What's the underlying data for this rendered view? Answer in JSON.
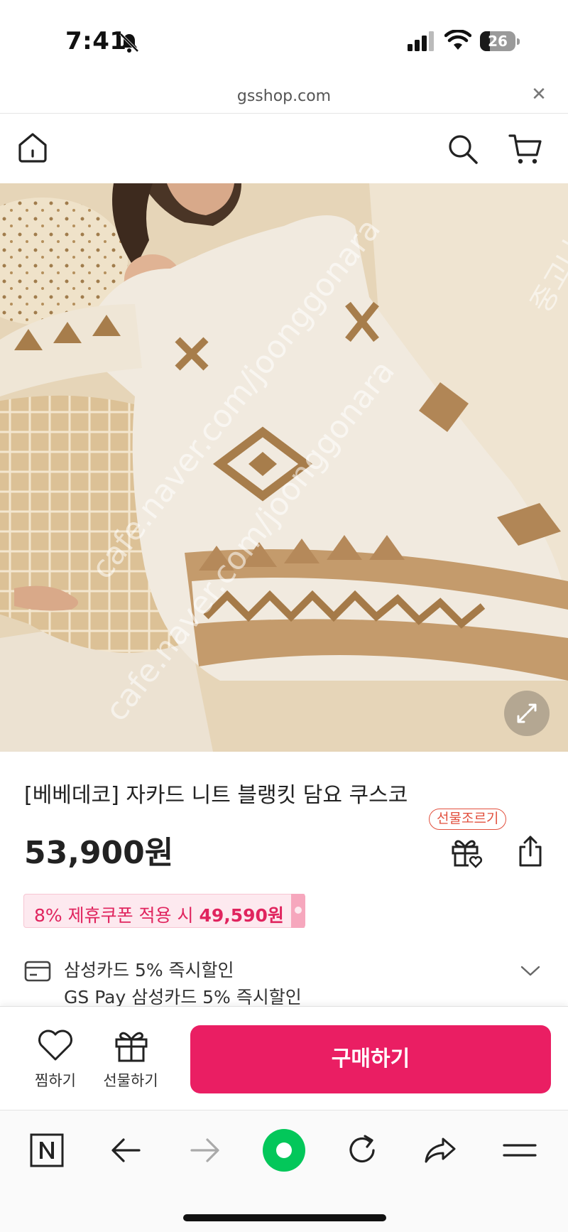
{
  "status_bar": {
    "time": "7:41",
    "battery_level": "26"
  },
  "url_bar": {
    "domain": "gsshop.com"
  },
  "product": {
    "title": "[베베데코] 자카드 니트 블랭킷 담요 쿠스코",
    "price": "53,900원",
    "gift_badge": "선물조르기",
    "coupon_prefix": "8% 제휴쿠폰 적용 시 ",
    "coupon_price": "49,590원",
    "card_discount_1": "삼성카드 5% 즉시할인",
    "card_discount_2": "GS Pay 삼성카드 5% 즉시할인"
  },
  "hero_image": {
    "watermark_1": "cafe.naver.com/joonggonara",
    "watermark_2": "cafe.naver.com/joonggonara",
    "watermark_3": "중고나라"
  },
  "action_bar": {
    "wish_label": "찜하기",
    "gift_label": "선물하기",
    "buy_label": "구매하기"
  },
  "colors": {
    "accent": "#ea1e63",
    "coupon_bg": "#fde9ef",
    "gift_badge": "#e2503e",
    "naver_green": "#03c75a"
  },
  "icons": [
    "bell-off-icon",
    "signal-icon",
    "wifi-icon",
    "battery-icon",
    "close-icon",
    "home-icon",
    "search-icon",
    "cart-icon",
    "expand-icon",
    "gift-icon",
    "share-icon",
    "card-icon",
    "chevron-down-icon",
    "heart-icon",
    "naver-n-icon",
    "back-arrow-icon",
    "forward-arrow-icon",
    "naver-home-icon",
    "reload-icon",
    "share-forward-icon",
    "menu-icon"
  ]
}
